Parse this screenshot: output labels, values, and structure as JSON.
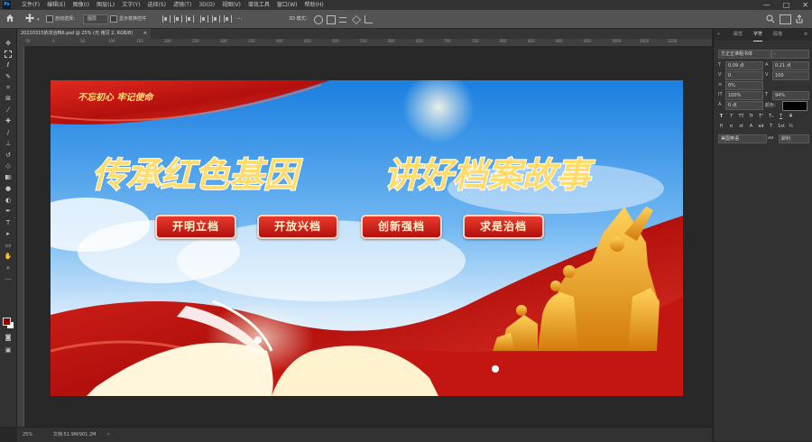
{
  "app": {
    "logo": "Ps"
  },
  "menu": [
    "文件(F)",
    "编辑(E)",
    "图像(I)",
    "图层(L)",
    "文字(Y)",
    "选择(S)",
    "滤镜(T)",
    "3D(D)",
    "视图(V)",
    "增效工具",
    "窗口(W)",
    "帮助(H)"
  ],
  "window_controls": [
    "—",
    "□",
    "✕"
  ],
  "options": {
    "auto_select_label": "自动选择：",
    "auto_select_value": "图层",
    "transform_label": "显示变换控件",
    "mode_3d_label": "3D 模式：",
    "more_label": "···"
  },
  "document": {
    "tab_title": "20220315依法治档6.psd @ 25% (光 拷贝 2, RGB/8)",
    "zoom": "25%",
    "status_doc": "文档:51.9M/901.2M"
  },
  "ruler": [
    "-50",
    "0",
    "50",
    "100",
    "150",
    "200",
    "250",
    "300",
    "350",
    "400",
    "450",
    "500",
    "550",
    "600",
    "650",
    "700",
    "750",
    "800",
    "850",
    "900",
    "950",
    "1000",
    "1050",
    "1100"
  ],
  "banner": {
    "top_left_text": "不忘初心 牢记使命",
    "title_left": "传承红色基因",
    "title_right": "讲好档案故事",
    "buttons": [
      "开明立档",
      "开放兴档",
      "创新强档",
      "求是治档"
    ]
  },
  "panel": {
    "tabs": [
      "属性",
      "字符",
      "段落"
    ],
    "active_tab": "字符",
    "font_family": "方正正准粗书体",
    "font_style": "-",
    "font_size": "0.09 点",
    "leading": "0.21 点",
    "kerning": "0",
    "tracking": "100",
    "baseline_pct": "0%",
    "vscale": "100%",
    "hscale": "94%",
    "baseline_shift": "0 点",
    "color_label": "颜色：",
    "type_buttons": [
      "T",
      "T",
      "TT",
      "Tr",
      "T¹",
      "T₁",
      "T",
      "T"
    ],
    "opentype_buttons": [
      "fi",
      "σ",
      "st",
      "A",
      "aā",
      "T",
      "1st",
      "½"
    ],
    "language": "美国英语",
    "antialias_label": "aa",
    "antialias": "犀利",
    "colors": {
      "text_color": "#000000"
    }
  },
  "tools": [
    "move",
    "marquee",
    "lasso",
    "magic-wand",
    "crop",
    "eyedropper",
    "healing",
    "brush",
    "stamp",
    "history-brush",
    "eraser",
    "gradient",
    "blur",
    "dodge",
    "pen",
    "type",
    "path-select",
    "rectangle",
    "hand",
    "zoom",
    "more"
  ],
  "colors": {
    "fg": "#8c0000",
    "bg": "#ffffff",
    "accent": "#31a8ff"
  }
}
